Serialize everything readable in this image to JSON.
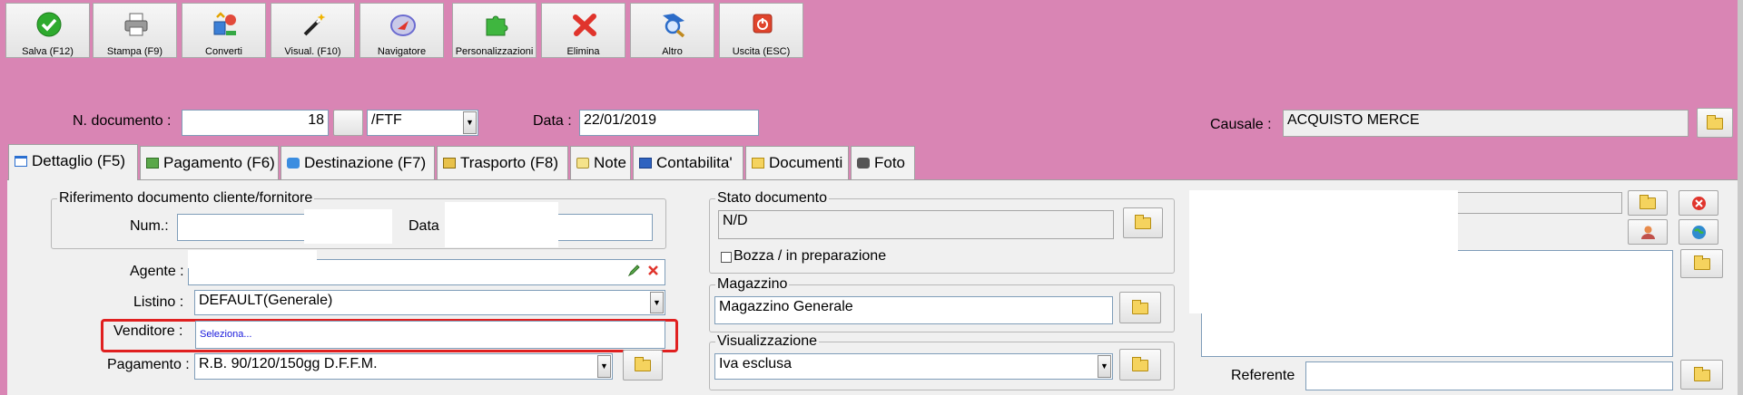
{
  "toolbar": {
    "buttons": [
      {
        "label": "Salva (F12)",
        "icon": "check-icon",
        "color": "#2eaa2e"
      },
      {
        "label": "Stampa (F9)",
        "icon": "printer-icon",
        "color": "#8a8a8a"
      },
      {
        "label": "Converti",
        "icon": "convert-icon",
        "color": "#3c7fd6"
      },
      {
        "label": "Visual. (F10)",
        "icon": "magic-wand-icon",
        "color": "#222222"
      },
      {
        "label": "Navigatore",
        "icon": "compass-icon",
        "color": "#6b6bd0"
      },
      {
        "label": "Personalizzazioni",
        "icon": "puzzle-icon",
        "color": "#3fb63f"
      },
      {
        "label": "Elimina",
        "icon": "delete-x-icon",
        "color": "#e0342c"
      },
      {
        "label": "Altro",
        "icon": "magnifier-icon",
        "color": "#2c6cc8"
      },
      {
        "label": "Uscita (ESC)",
        "icon": "exit-icon",
        "color": "#e0442c"
      }
    ]
  },
  "header": {
    "doc_number_label": "N. documento :",
    "doc_number_value": "18",
    "doc_suffix_value": "/FTF",
    "date_label": "Data :",
    "date_value": "22/01/2019",
    "causale_label": "Causale :",
    "causale_value": "ACQUISTO MERCE"
  },
  "tabs": [
    {
      "label": "Dettaglio (F5)"
    },
    {
      "label": "Pagamento (F6)"
    },
    {
      "label": "Destinazione (F7)"
    },
    {
      "label": "Trasporto (F8)"
    },
    {
      "label": "Note"
    },
    {
      "label": "Contabilita'"
    },
    {
      "label": "Documenti"
    },
    {
      "label": "Foto"
    }
  ],
  "detail": {
    "rif_group_label": "Riferimento documento cliente/fornitore",
    "num_label": "Num.:",
    "num_value": "",
    "data_label": "Data",
    "data_value": "",
    "agente_label": "Agente :",
    "listino_label": "Listino :",
    "listino_value": "DEFAULT(Generale)",
    "venditore_label": "Venditore :",
    "venditore_value": "Seleziona...",
    "pagamento_label": "Pagamento :",
    "pagamento_value": "R.B. 90/120/150gg D.F.F.M.",
    "stato_group_label": "Stato documento",
    "stato_value": "N/D",
    "bozza_label": "Bozza / in preparazione",
    "magazzino_group_label": "Magazzino",
    "magazzino_value": "Magazzino Generale",
    "visual_group_label": "Visualizzazione",
    "visual_value": "Iva esclusa",
    "referente_label": "Referente",
    "referente_value": ""
  },
  "colors": {
    "background": "#d985b4",
    "highlight_border": "#e02020",
    "link_text": "#1a1adc"
  }
}
